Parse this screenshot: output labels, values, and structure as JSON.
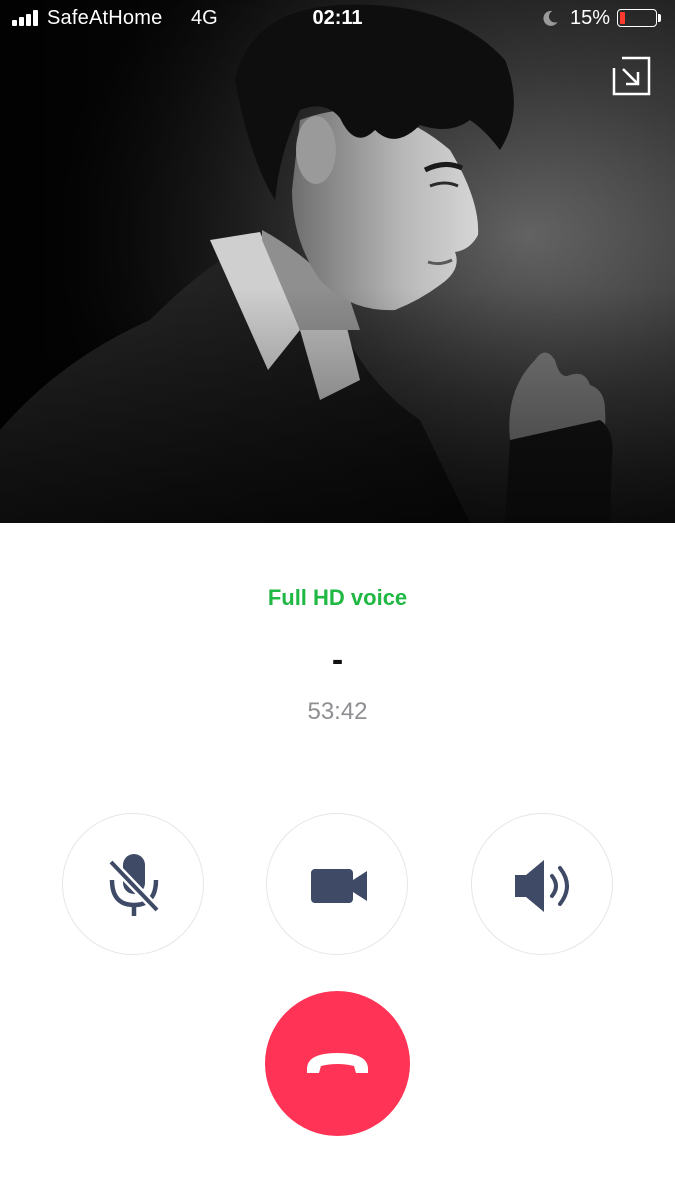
{
  "status_bar": {
    "carrier": "SafeAtHome",
    "network": "4G",
    "time": "02:11",
    "battery_percent": "15%",
    "battery_level": 0.15,
    "signal_bars": 4,
    "icons": {
      "signal": "cellular-signal-icon",
      "do_not_disturb": "moon-icon",
      "battery": "battery-icon"
    },
    "battery_low_color": "#ff3b30"
  },
  "photo": {
    "icon": "minimize-window-icon"
  },
  "call": {
    "quality_label": "Full HD voice",
    "caller_name": "-",
    "duration": "53:42",
    "quality_color": "#1fb843"
  },
  "controls": {
    "mute": {
      "icon": "microphone-muted-icon"
    },
    "video": {
      "icon": "video-camera-icon"
    },
    "speaker": {
      "icon": "speaker-volume-icon"
    },
    "end_call": {
      "icon": "phone-hangup-icon",
      "color": "#ff3355"
    },
    "icon_color": "#3f4a66"
  }
}
